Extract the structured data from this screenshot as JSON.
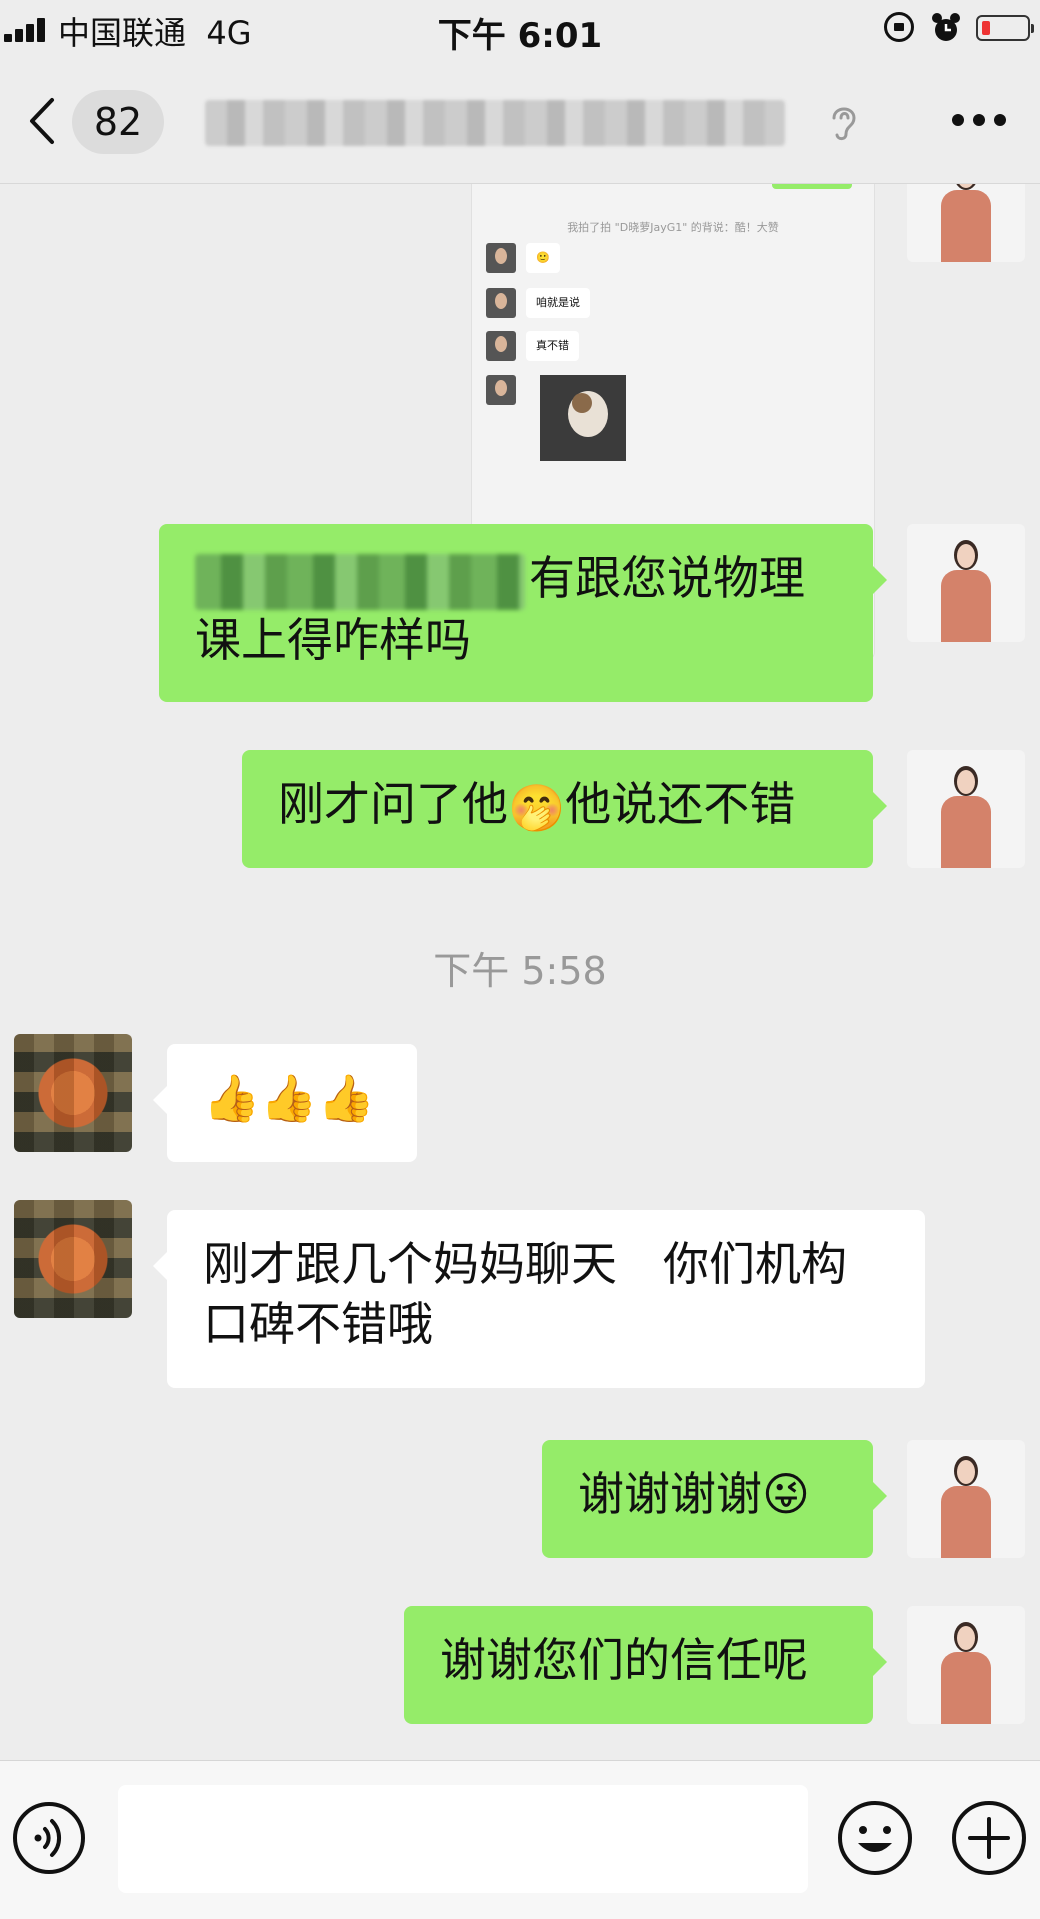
{
  "status_bar": {
    "carrier": "中国联通",
    "network": "4G",
    "time": "下午 6:01"
  },
  "nav": {
    "unread_count": "82"
  },
  "screenshot_card": {
    "system_note": "我拍了拍 \"D晓萝JayG1\" 的背说：酷！大赞",
    "messages": [
      "🙂",
      "咱就是说",
      "真不错"
    ]
  },
  "messages": [
    {
      "side": "me",
      "text": "有跟您说物理课上得咋样吗"
    },
    {
      "side": "me",
      "text_before": "刚才问了他",
      "emoji": "🤭",
      "text_after": "他说还不错"
    },
    {
      "type": "timestamp",
      "text": "下午 5:58"
    },
    {
      "side": "other",
      "text": "👍👍👍"
    },
    {
      "side": "other",
      "text": "刚才跟几个妈妈聊天　你们机构口碑不错哦"
    },
    {
      "side": "me",
      "text": "谢谢谢谢😜"
    },
    {
      "side": "me",
      "text": "谢谢您们的信任呢"
    }
  ],
  "colors": {
    "my_bubble": "#95ec69",
    "other_bubble": "#ffffff",
    "background": "#ededed"
  },
  "icons": [
    "signal-icon",
    "lock-rotation-icon",
    "alarm-icon",
    "battery-icon",
    "back-chevron-icon",
    "ear-icon",
    "more-icon",
    "voice-icon",
    "emoji-icon",
    "plus-icon"
  ]
}
